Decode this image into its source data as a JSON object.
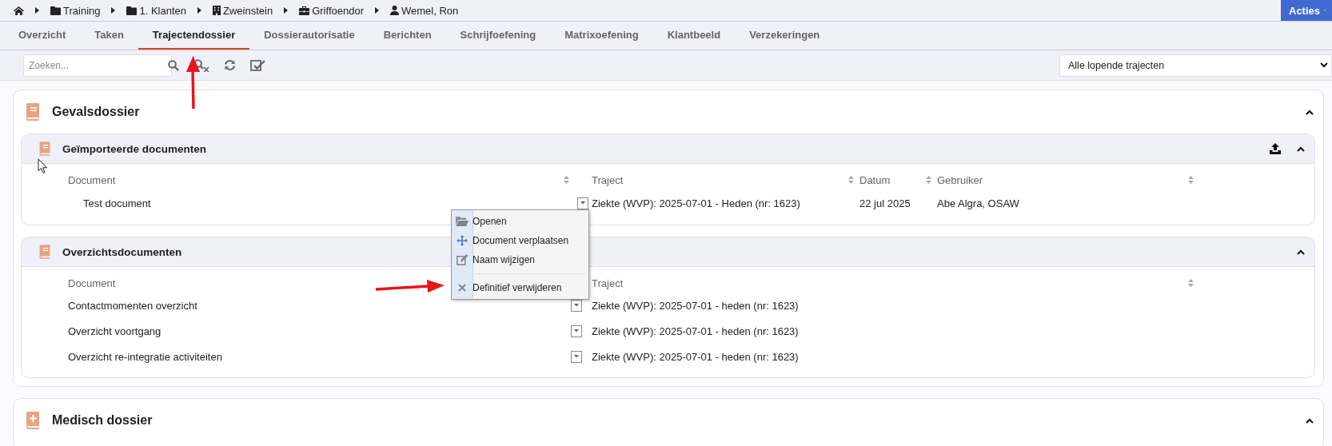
{
  "breadcrumb": [
    {
      "label": "Training",
      "kind": "folder"
    },
    {
      "label": "1. Klanten",
      "kind": "folder"
    },
    {
      "label": "Zweinstein",
      "kind": "building"
    },
    {
      "label": "Griffoendor",
      "kind": "briefcase"
    },
    {
      "label": "Wemel, Ron",
      "kind": "person"
    }
  ],
  "actions_button": "Acties",
  "tabs": [
    {
      "label": "Overzicht",
      "selected": false
    },
    {
      "label": "Taken",
      "selected": false
    },
    {
      "label": "Trajectendossier",
      "selected": true
    },
    {
      "label": "Dossierautorisatie",
      "selected": false
    },
    {
      "label": "Berichten",
      "selected": false
    },
    {
      "label": "Schrijfoefening",
      "selected": false
    },
    {
      "label": "Matrixoefening",
      "selected": false
    },
    {
      "label": "Klantbeeld",
      "selected": false
    },
    {
      "label": "Verzekeringen",
      "selected": false
    }
  ],
  "search": {
    "placeholder": "Zoeken..."
  },
  "filter_select": {
    "value": "Alle lopende trajecten"
  },
  "sections": [
    {
      "title": "Gevalsdossier",
      "kind": "book",
      "expanded": true,
      "subsections": [
        {
          "title": "Geïmporteerde documenten",
          "kind": "imported",
          "upload": true,
          "expanded": true,
          "columns": [
            "Document",
            "Traject",
            "Datum",
            "Gebruiker"
          ],
          "rows": [
            {
              "cells": [
                "Test document",
                "Ziekte (WVP): 2025-07-01 - Heden (nr: 1623)",
                "22 jul 2025",
                "Abe Algra, OSAW"
              ]
            }
          ]
        },
        {
          "title": "Overzichtsdocumenten",
          "kind": "overview",
          "upload": false,
          "expanded": true,
          "columns": [
            "Document",
            "Traject"
          ],
          "rows": [
            {
              "cells": [
                "Contactmomenten overzicht",
                "Ziekte (WVP): 2025-07-01 - heden (nr: 1623)"
              ]
            },
            {
              "cells": [
                "Overzicht voortgang",
                "Ziekte (WVP): 2025-07-01 - heden (nr: 1623)"
              ]
            },
            {
              "cells": [
                "Overzicht re-integratie activiteiten",
                "Ziekte (WVP): 2025-07-01 - heden (nr: 1623)"
              ]
            }
          ]
        }
      ]
    },
    {
      "title": "Medisch dossier",
      "kind": "medical",
      "expanded": true
    }
  ],
  "context_menu": {
    "items": [
      {
        "label": "Openen",
        "kind": "open",
        "separator_before": false
      },
      {
        "label": "Document verplaatsen",
        "kind": "move",
        "separator_before": false
      },
      {
        "label": "Naam wijzigen",
        "kind": "rename",
        "separator_before": false
      },
      {
        "label": "Definitief verwijderen",
        "kind": "delete",
        "separator_before": true
      }
    ]
  }
}
